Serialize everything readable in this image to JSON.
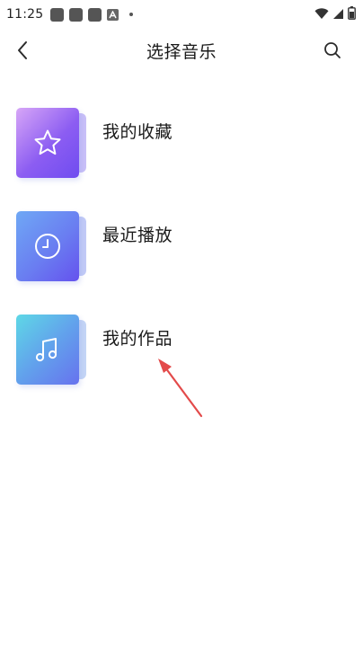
{
  "status_bar": {
    "time": "11:25",
    "icons": [
      "app-icon",
      "app-icon",
      "app-icon",
      "a-icon",
      "dot-icon",
      "wifi-icon",
      "signal-icon",
      "battery-icon"
    ]
  },
  "header": {
    "title": "选择音乐",
    "back_icon": "chevron-left-icon",
    "search_icon": "search-icon"
  },
  "items": [
    {
      "label": "我的收藏",
      "icon": "star-icon",
      "gradient": [
        "#d7a6f7",
        "#6f4cf0"
      ],
      "back_color": "#c9c0f8"
    },
    {
      "label": "最近播放",
      "icon": "clock-icon",
      "gradient": [
        "#6fa8f5",
        "#6552ee"
      ],
      "back_color": "#c2cbf7"
    },
    {
      "label": "我的作品",
      "icon": "music-note-icon",
      "gradient": [
        "#5ed8e6",
        "#6772ee"
      ],
      "back_color": "#c5d6f6"
    }
  ],
  "colors": {
    "annotation_arrow": "#e34a4a",
    "text": "#1a1a1a"
  }
}
